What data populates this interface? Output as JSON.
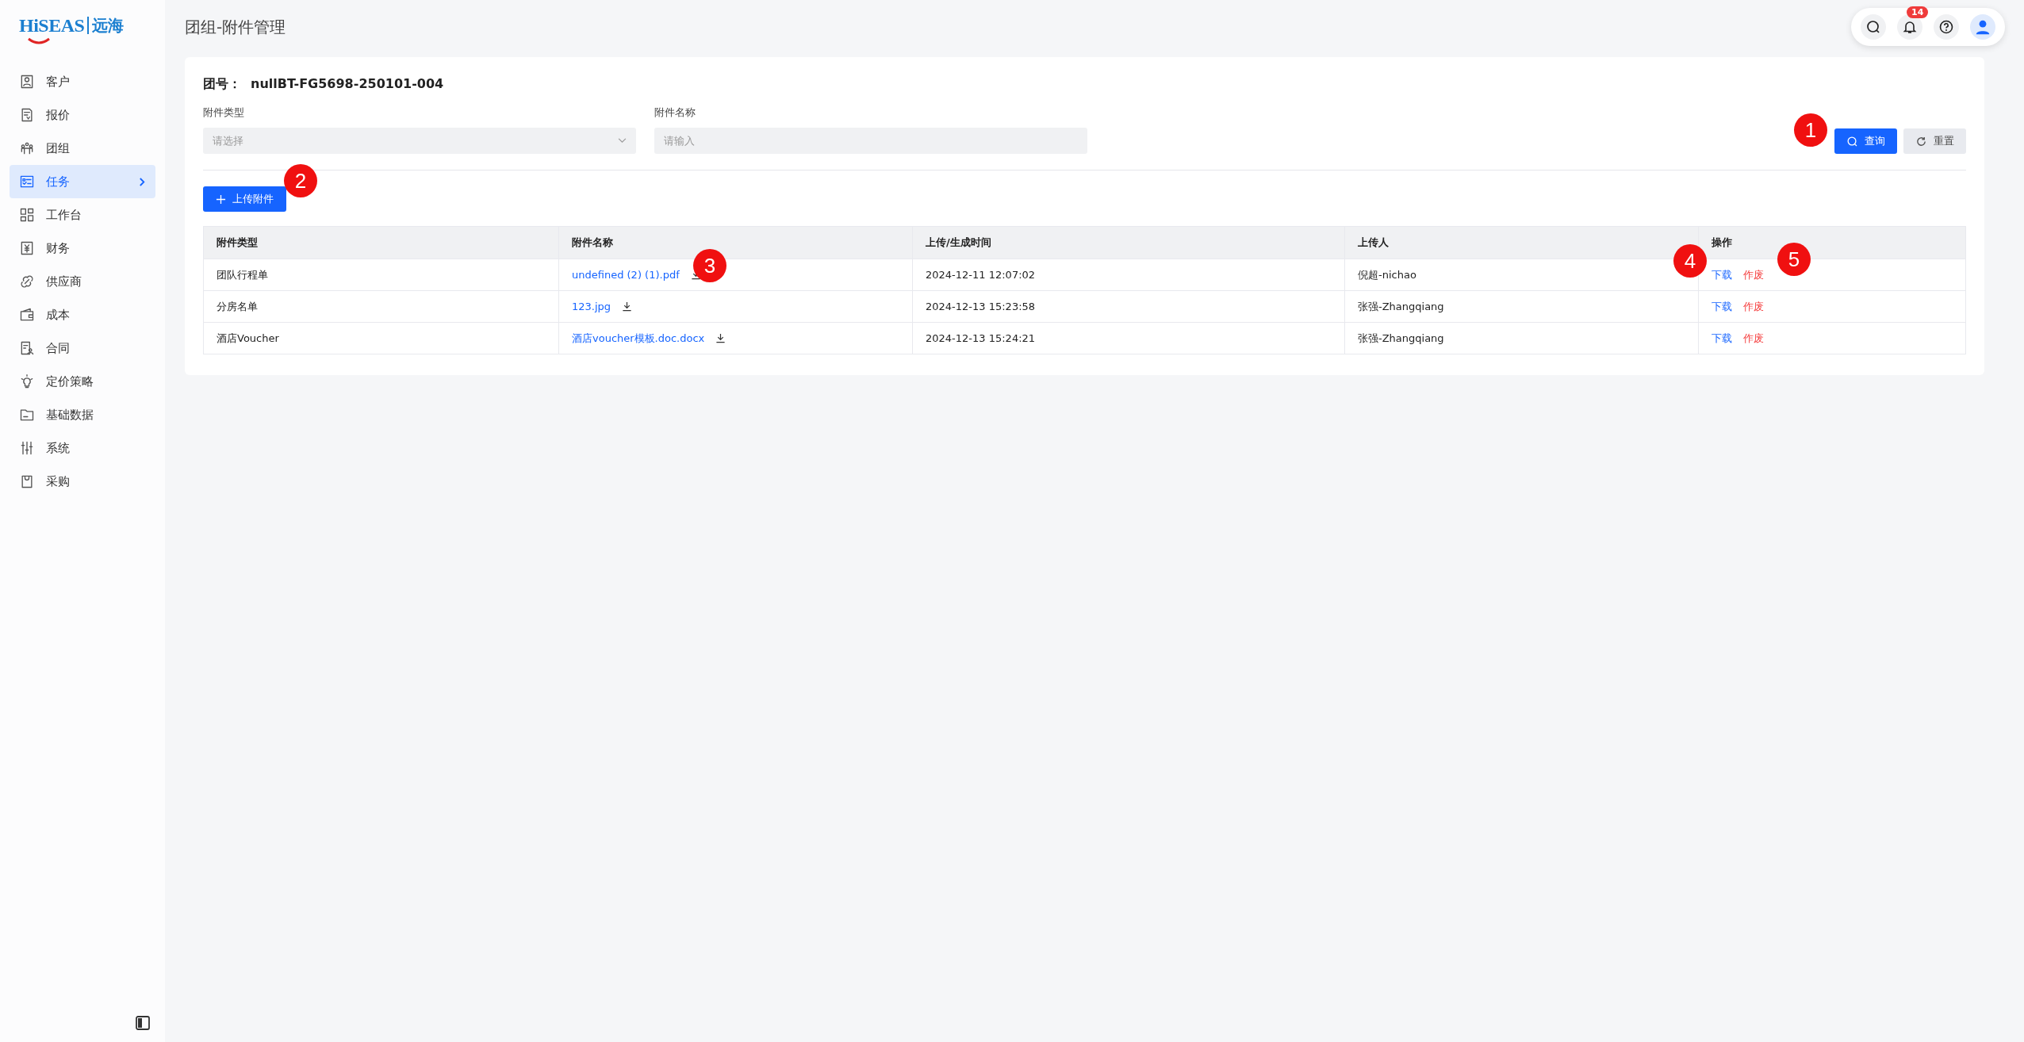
{
  "brand": {
    "latin": "HiSEAS",
    "chinese": "远海"
  },
  "sidebar": {
    "items": [
      {
        "label": "客户",
        "selected": false
      },
      {
        "label": "报价",
        "selected": false
      },
      {
        "label": "团组",
        "selected": false
      },
      {
        "label": "任务",
        "selected": true
      },
      {
        "label": "工作台",
        "selected": false
      },
      {
        "label": "财务",
        "selected": false
      },
      {
        "label": "供应商",
        "selected": false
      },
      {
        "label": "成本",
        "selected": false
      },
      {
        "label": "合同",
        "selected": false
      },
      {
        "label": "定价策略",
        "selected": false
      },
      {
        "label": "基础数据",
        "selected": false
      },
      {
        "label": "系统",
        "selected": false
      },
      {
        "label": "采购",
        "selected": false
      }
    ]
  },
  "header": {
    "title": "团组-附件管理",
    "notification_count": "14"
  },
  "group": {
    "label": "团号：",
    "value": "nullBT-FG5698-250101-004"
  },
  "filters": [
    {
      "label": "附件类型",
      "placeholder": "请选择",
      "kind": "select"
    },
    {
      "label": "附件名称",
      "placeholder": "请输入",
      "kind": "input"
    }
  ],
  "buttons": {
    "query": "查询",
    "reset": "重置",
    "upload": "上传附件"
  },
  "table": {
    "columns": [
      "附件类型",
      "附件名称",
      "上传/生成时间",
      "上传人",
      "操作"
    ],
    "rows": [
      {
        "type": "团队行程单",
        "name": "undefined (2) (1).pdf",
        "time": "2024-12-11 12:07:02",
        "uploader": "倪超-nichao",
        "actions": [
          {
            "label": "下载",
            "kind": "link"
          },
          {
            "label": "作废",
            "kind": "danger"
          }
        ]
      },
      {
        "type": "分房名单",
        "name": "123.jpg",
        "time": "2024-12-13 15:23:58",
        "uploader": "张强-Zhangqiang",
        "actions": [
          {
            "label": "下载",
            "kind": "link"
          },
          {
            "label": "作废",
            "kind": "danger"
          }
        ]
      },
      {
        "type": "酒店Voucher",
        "name": "酒店voucher模板.doc.docx",
        "time": "2024-12-13 15:24:21",
        "uploader": "张强-Zhangqiang",
        "actions": [
          {
            "label": "下载",
            "kind": "link"
          },
          {
            "label": "作废",
            "kind": "danger"
          }
        ]
      }
    ]
  },
  "callouts": [
    "1",
    "2",
    "3",
    "4",
    "5"
  ]
}
